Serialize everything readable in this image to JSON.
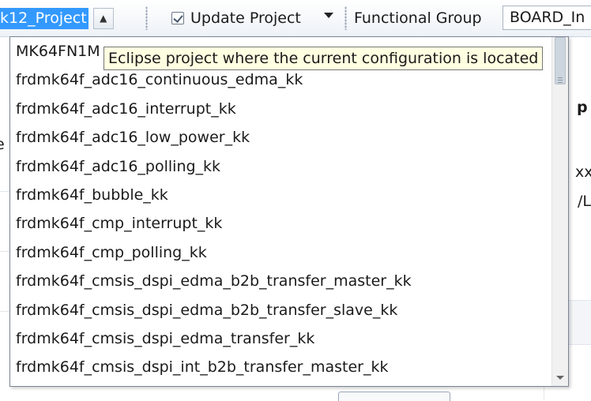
{
  "toolbar": {
    "project_combo": "k12_Project",
    "update_label": "Update Project",
    "functional_group_label": "Functional Group",
    "functional_group_value": "BOARD_In"
  },
  "background": {
    "left_fragment": "e",
    "right_fragment_1": "p",
    "right_fragment_2": "xxx",
    "right_fragment_3": "/LL"
  },
  "tooltip": "Eclipse project where the current configuration is located",
  "dropdown": {
    "items": [
      "MK64FN1M",
      "frdmk64f_adc16_continuous_edma_kk",
      "frdmk64f_adc16_interrupt_kk",
      "frdmk64f_adc16_low_power_kk",
      "frdmk64f_adc16_polling_kk",
      "frdmk64f_bubble_kk",
      "frdmk64f_cmp_interrupt_kk",
      "frdmk64f_cmp_polling_kk",
      "frdmk64f_cmsis_dspi_edma_b2b_transfer_master_kk",
      "frdmk64f_cmsis_dspi_edma_b2b_transfer_slave_kk",
      "frdmk64f_cmsis_dspi_edma_transfer_kk",
      "frdmk64f_cmsis_dspi_int_b2b_transfer_master_kk"
    ]
  },
  "colors": {
    "selection": "#3399ff",
    "tooltip_bg": "#ffffe1"
  }
}
